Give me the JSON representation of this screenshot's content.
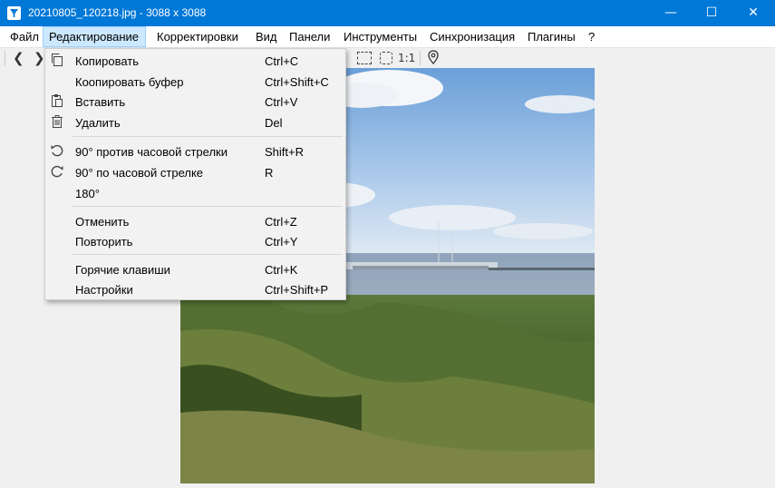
{
  "window": {
    "title": "20210805_120218.jpg  -  3088 x 3088",
    "minimize": "—",
    "maximize": "☐",
    "close": "✕"
  },
  "menubar": {
    "items": [
      {
        "label": "Файл"
      },
      {
        "label": "Редактирование"
      },
      {
        "label": "Корректировки"
      },
      {
        "label": "Вид"
      },
      {
        "label": "Панели"
      },
      {
        "label": "Инструменты"
      },
      {
        "label": "Синхронизация"
      },
      {
        "label": "Плагины"
      },
      {
        "label": "?"
      }
    ]
  },
  "toolbar": {
    "prev_icon": "chevron-left-icon",
    "next_icon": "chevron-right-icon",
    "actual_size_label": "1:1",
    "location_icon": "map-pin-icon"
  },
  "edit_menu": {
    "items": [
      {
        "label": "Копировать",
        "shortcut": "Ctrl+C",
        "icon": "copy-icon"
      },
      {
        "label": "Коопировать буфер",
        "shortcut": "Ctrl+Shift+C"
      },
      {
        "label": "Вставить",
        "shortcut": "Ctrl+V",
        "icon": "paste-icon"
      },
      {
        "label": "Удалить",
        "shortcut": "Del",
        "icon": "trash-icon"
      },
      {
        "label": "90° против часовой стрелки",
        "shortcut": "Shift+R",
        "icon": "rotate-ccw-icon"
      },
      {
        "label": "90° по часовой стрелке",
        "shortcut": "R",
        "icon": "rotate-cw-icon"
      },
      {
        "label": "180°",
        "shortcut": ""
      },
      {
        "label": "Отменить",
        "shortcut": "Ctrl+Z"
      },
      {
        "label": "Повторить",
        "shortcut": "Ctrl+Y"
      },
      {
        "label": "Горячие клавиши",
        "shortcut": "Ctrl+K"
      },
      {
        "label": "Настройки",
        "shortcut": "Ctrl+Shift+P"
      }
    ]
  }
}
